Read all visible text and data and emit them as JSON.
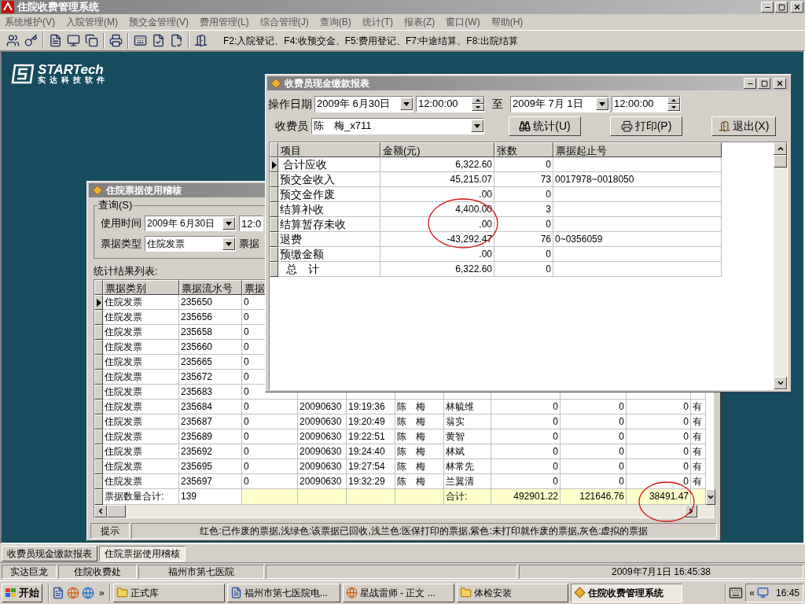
{
  "app": {
    "title": "住院收费管理系统"
  },
  "menu": [
    "系统维护(V)",
    "入院管理(M)",
    "预交金管理(V)",
    "费用管理(L)",
    "综合管理(J)",
    "查询(B)",
    "统计(T)",
    "报表(Z)",
    "窗口(W)",
    "帮助(H)"
  ],
  "toolbar": {
    "hint": "F2:入院登记、F4:收预交金、F5:费用登记、F7:中途结算、F8:出院结算"
  },
  "logo": {
    "brand": "STARTech",
    "tagline": "实达科技软件"
  },
  "audit_window": {
    "title": "住院票据使用稽核",
    "group_label": "查询(S)",
    "query": [
      {
        "label": "使用时间",
        "value": "2009年 6月30日",
        "extra": "12:0"
      },
      {
        "label": "票据类型",
        "value": "住院发票",
        "extra": "票据"
      }
    ],
    "list_label": "统计结果列表:",
    "columns": [
      "票据类别",
      "票据流水号",
      "票据"
    ],
    "rows": [
      {
        "selected": true,
        "cells": [
          "住院发票",
          "235650",
          "0"
        ]
      },
      {
        "selected": false,
        "cells": [
          "住院发票",
          "235656",
          "0"
        ]
      },
      {
        "selected": false,
        "cells": [
          "住院发票",
          "235658",
          "0"
        ]
      },
      {
        "selected": false,
        "cells": [
          "住院发票",
          "235660",
          "0"
        ]
      },
      {
        "selected": false,
        "cells": [
          "住院发票",
          "235665",
          "0"
        ]
      },
      {
        "selected": false,
        "cells": [
          "住院发票",
          "235672",
          "0"
        ]
      },
      {
        "selected": false,
        "cells": [
          "住院发票",
          "235683",
          "0"
        ]
      },
      {
        "selected": false,
        "cells": [
          "住院发票",
          "235684",
          "0",
          "20090630",
          "19:19:36",
          "陈　梅",
          "林毓维",
          "0",
          "0",
          "0",
          "有"
        ]
      },
      {
        "selected": false,
        "cells": [
          "住院发票",
          "235687",
          "0",
          "20090630",
          "19:20:49",
          "陈　梅",
          "翁实",
          "0",
          "0",
          "0",
          "有"
        ]
      },
      {
        "selected": false,
        "cells": [
          "住院发票",
          "235689",
          "0",
          "20090630",
          "19:22:51",
          "陈　梅",
          "黄智",
          "0",
          "0",
          "0",
          "有"
        ]
      },
      {
        "selected": false,
        "cells": [
          "住院发票",
          "235692",
          "0",
          "20090630",
          "19:24:40",
          "陈　梅",
          "林斌",
          "0",
          "0",
          "0",
          "有"
        ]
      },
      {
        "selected": false,
        "cells": [
          "住院发票",
          "235695",
          "0",
          "20090630",
          "19:27:54",
          "陈　梅",
          "林常先",
          "0",
          "0",
          "0",
          "有"
        ]
      },
      {
        "selected": false,
        "cells": [
          "住院发票",
          "235697",
          "0",
          "20090630",
          "19:32:29",
          "陈　梅",
          "兰翼清",
          "0",
          "0",
          "0",
          "有"
        ]
      }
    ],
    "totals": {
      "count_label": "票据数量合计:",
      "count": "139",
      "sum_label": "合计:",
      "sums": [
        "492901.22",
        "121646.76",
        "38491.47"
      ]
    },
    "hint_label": "提示",
    "hint": "红色:已作废的票据,浅绿色:该票据已回收,浅兰色:医保打印的票据,紫色:未打印就作废的票据,灰色:虚拟的票据"
  },
  "report_window": {
    "title": "收费员现金缴款报表",
    "date_label": "操作日期",
    "from_date": "2009年 6月30日",
    "from_time": "12:00:00",
    "to_label": "至",
    "to_date": "2009年 7月 1日",
    "to_time": "12:00:00",
    "cashier_label": "收费员",
    "cashier": "陈　梅_x711",
    "buttons": [
      {
        "label": "统计(U)",
        "kind": "search"
      },
      {
        "label": "打印(P)",
        "kind": "print"
      },
      {
        "label": "退出(X)",
        "kind": "exit"
      }
    ],
    "columns": [
      "项目",
      "金额(元)",
      "张数",
      "票据起止号"
    ],
    "rows": [
      {
        "selected": true,
        "cells": [
          " 合计应收",
          "6,322.60",
          "0"
        ]
      },
      {
        "selected": false,
        "cells": [
          "预交金收入",
          "45,215.07",
          "73",
          "0017978~0018050"
        ]
      },
      {
        "selected": false,
        "cells": [
          "预交金作废",
          ".00",
          "0"
        ]
      },
      {
        "selected": false,
        "cells": [
          "结算补收",
          "4,400.00",
          "3"
        ]
      },
      {
        "selected": false,
        "cells": [
          "结算暂存未收",
          ".00",
          "0"
        ]
      },
      {
        "selected": false,
        "cells": [
          "退费",
          "-43,292.47",
          "76",
          "0~0356059"
        ]
      },
      {
        "selected": false,
        "cells": [
          "预缴金额",
          ".00",
          "0"
        ]
      },
      {
        "selected": false,
        "cells": [
          "  总　计",
          "6,322.60",
          "0"
        ]
      }
    ]
  },
  "window_tabs": [
    {
      "label": "收费员现金缴款报表",
      "selected": false
    },
    {
      "label": "住院票据使用稽核",
      "selected": true
    }
  ],
  "status_bar": {
    "panels": [
      "实达巨龙",
      "住院收费处",
      "福州市第七医院"
    ],
    "datetime": "2009年7月1日 16:45:38"
  },
  "taskbar": {
    "start": "开始",
    "overflow": "»",
    "tasks": [
      {
        "label": "正式库",
        "kind": "folder",
        "selected": false
      },
      {
        "label": "福州市第七医院电...",
        "kind": "document",
        "selected": false
      },
      {
        "label": "星战雷师 - 正文 ...",
        "kind": "browser",
        "selected": false
      },
      {
        "label": "体检安装",
        "kind": "folder",
        "selected": false
      },
      {
        "label": "住院收费管理系统",
        "kind": "app",
        "selected": true
      }
    ],
    "tray_expand": "«",
    "clock": "16:45"
  }
}
